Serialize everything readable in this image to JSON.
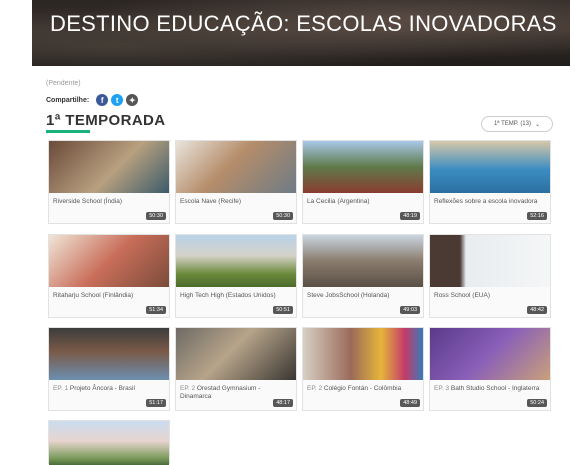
{
  "page": {
    "title": "DESTINO EDUCAÇÃO: ESCOLAS INOVADORAS",
    "pending": "(Pendente)",
    "share_label": "Compartilhe:",
    "share_icons": [
      "facebook-icon",
      "twitter-icon",
      "share-icon"
    ]
  },
  "season": {
    "title": "1ª TEMPORADA",
    "select_label": "1ª TEMP. (13)",
    "accent_color": "#19b27a"
  },
  "episodes": [
    {
      "title": "Riverside School (Índia)",
      "duration": "50:30",
      "ep": ""
    },
    {
      "title": "Escola Nave (Recife)",
      "duration": "50:30",
      "ep": ""
    },
    {
      "title": "La Cecilia (Argentina)",
      "duration": "48:19",
      "ep": ""
    },
    {
      "title": "Reflexões sobre a escola inovadora",
      "duration": "52:16",
      "ep": ""
    },
    {
      "title": "Ritaharju School (Finlândia)",
      "duration": "51:34",
      "ep": ""
    },
    {
      "title": "High Tech High (Estados Unidos)",
      "duration": "50:51",
      "ep": ""
    },
    {
      "title": "Steve JobsSchool (Holanda)",
      "duration": "49:03",
      "ep": ""
    },
    {
      "title": "Ross School (EUA)",
      "duration": "48:42",
      "ep": ""
    },
    {
      "title": "Projeto Âncora - Brasil",
      "duration": "51:17",
      "ep": "EP. 1"
    },
    {
      "title": "Orestad Gymnasium - Dinamarca",
      "duration": "48:17",
      "ep": "EP. 2"
    },
    {
      "title": "Colégio Fontán - Colômbia",
      "duration": "48:49",
      "ep": "EP. 2"
    },
    {
      "title": "Bath Studio School - Inglaterra",
      "duration": "50:24",
      "ep": "EP. 3"
    },
    {
      "title": "",
      "duration": "",
      "ep": ""
    }
  ]
}
